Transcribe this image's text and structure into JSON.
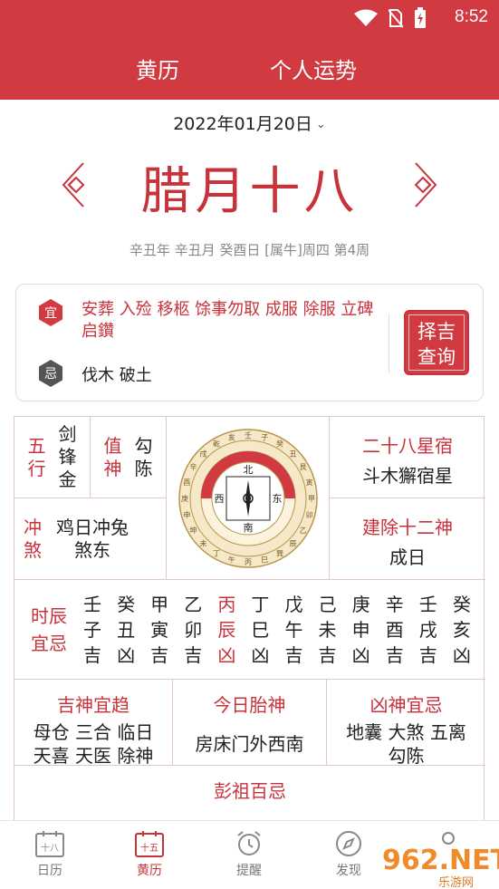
{
  "status_bar": {
    "time": "8:52"
  },
  "tabs": [
    {
      "label": "黄历"
    },
    {
      "label": "个人运势"
    }
  ],
  "date_selector": {
    "date": "2022年01月20日"
  },
  "lunar": {
    "day": "腊月十八",
    "ganzhi": "辛丑年 辛丑月 癸酉日 [属牛]周四 第4周"
  },
  "yiji": {
    "yi_label": "宜",
    "yi": "安葬 入殓 移柩 馀事勿取 成服 除服 立碑 启鑽",
    "ji_label": "忌",
    "ji": "伐木 破土",
    "button": [
      "择吉",
      "查询"
    ]
  },
  "almanac": {
    "wuxing": {
      "label": [
        "五",
        "行"
      ],
      "value": [
        "剑",
        "锋",
        "金"
      ]
    },
    "zhishen": {
      "label": [
        "值",
        "神"
      ],
      "value": [
        "勾",
        "陈"
      ]
    },
    "xingsu": {
      "label": "二十八星宿",
      "value": "斗木獬宿星"
    },
    "chongsha": {
      "label": [
        "冲",
        "煞"
      ],
      "value": [
        "鸡日冲兔",
        "煞东"
      ]
    },
    "jianchu": {
      "label": "建除十二神",
      "value": "成日"
    },
    "shichen": {
      "label": [
        "时辰",
        "宜忌"
      ],
      "hours": [
        {
          "gan": "壬",
          "zhi": "子",
          "luck": "吉",
          "current": false
        },
        {
          "gan": "癸",
          "zhi": "丑",
          "luck": "凶",
          "current": false
        },
        {
          "gan": "甲",
          "zhi": "寅",
          "luck": "吉",
          "current": false
        },
        {
          "gan": "乙",
          "zhi": "卯",
          "luck": "吉",
          "current": false
        },
        {
          "gan": "丙",
          "zhi": "辰",
          "luck": "凶",
          "current": true
        },
        {
          "gan": "丁",
          "zhi": "巳",
          "luck": "凶",
          "current": false
        },
        {
          "gan": "戊",
          "zhi": "午",
          "luck": "吉",
          "current": false
        },
        {
          "gan": "己",
          "zhi": "未",
          "luck": "吉",
          "current": false
        },
        {
          "gan": "庚",
          "zhi": "申",
          "luck": "凶",
          "current": false
        },
        {
          "gan": "辛",
          "zhi": "酉",
          "luck": "吉",
          "current": false
        },
        {
          "gan": "壬",
          "zhi": "戌",
          "luck": "吉",
          "current": false
        },
        {
          "gan": "癸",
          "zhi": "亥",
          "luck": "凶",
          "current": false
        }
      ]
    },
    "jishen": {
      "label": "吉神宜趋",
      "value": [
        "母仓 三合 临日",
        "天喜 天医 除神"
      ]
    },
    "taishen": {
      "label": "今日胎神",
      "value": "房床门外西南"
    },
    "xiongshen": {
      "label": "凶神宜忌",
      "value": [
        "地囊 大煞 五离",
        "勾陈"
      ]
    },
    "pengzu": {
      "label": "彭祖百忌"
    },
    "luopan": {
      "directions": [
        "北",
        "东",
        "南",
        "西"
      ],
      "ring_text": [
        "壬",
        "子",
        "癸",
        "丑",
        "艮",
        "寅",
        "甲",
        "卯",
        "乙",
        "辰",
        "巽",
        "巳",
        "丙",
        "午",
        "丁",
        "未",
        "坤",
        "申",
        "庚",
        "酉",
        "辛",
        "戌",
        "乾",
        "亥"
      ]
    }
  },
  "bottom_nav": [
    {
      "label": "日历",
      "icon": "calendar-icon",
      "icon_text": "十八"
    },
    {
      "label": "黄历",
      "icon": "almanac-icon",
      "icon_text": "十五"
    },
    {
      "label": "提醒",
      "icon": "alarm-clock-icon"
    },
    {
      "label": "发现",
      "icon": "compass-icon"
    },
    {
      "label": "",
      "icon": "profile-icon"
    }
  ],
  "watermark": {
    "text": "962",
    "sub": "乐游网"
  },
  "colors": {
    "primary": "#d03a40",
    "accent_text": "#c8323a",
    "border": "#e2c7c8"
  }
}
